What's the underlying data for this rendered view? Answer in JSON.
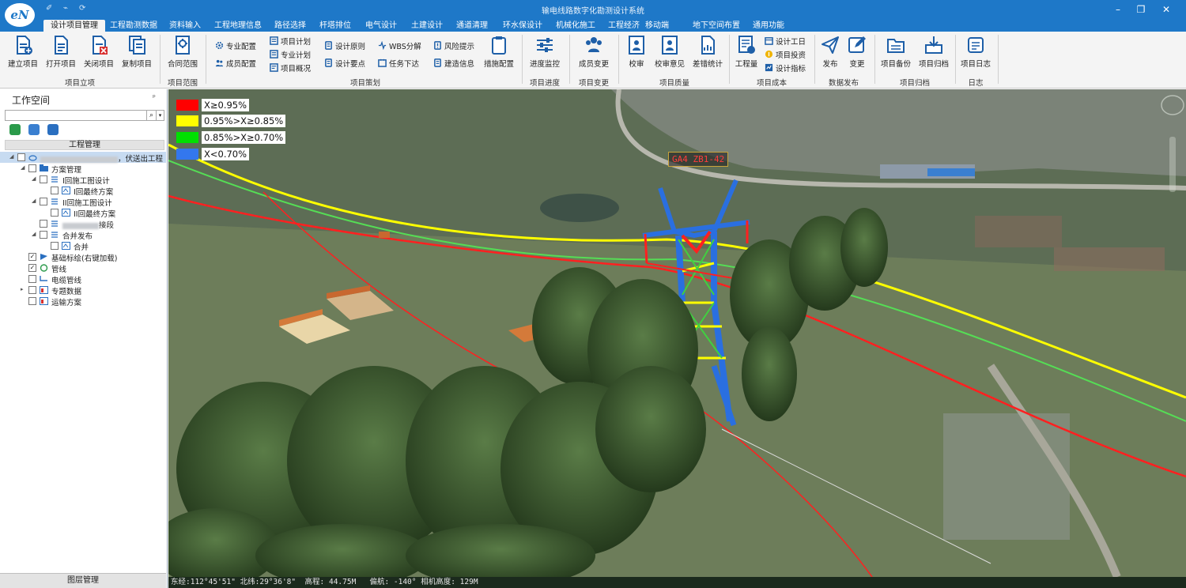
{
  "app": {
    "title": "输电线路数字化勘测设计系统",
    "logo_text": "eN",
    "quick_access": [
      "✐",
      "⌁",
      "⟳"
    ]
  },
  "tabs": [
    "设计项目管理",
    "工程勘测数据",
    "资料输入",
    "工程地理信息",
    "路径选择",
    "杆塔排位",
    "电气设计",
    "土建设计",
    "通道清理",
    "环水保设计",
    "机械化施工",
    "工程经济",
    "移动端",
    "地下空间布置",
    "通用功能"
  ],
  "ribbon": {
    "new_project": "建立项目",
    "open_project": "打开项目",
    "close_project": "关闭项目",
    "copy_project": "复制项目",
    "group_setup": "项目立项",
    "contract_scope": "合同范围",
    "group_scope": "项目范围",
    "specialty_config": "专业配置",
    "member_config": "成员配置",
    "project_plan": "项目计划",
    "specialty_plan": "专业计划",
    "project_overview": "项目概况",
    "design_principle": "设计原则",
    "design_points": "设计要点",
    "wbs": "WBS分解",
    "task_assign": "任务下达",
    "risk_tip": "风险提示",
    "construction_info": "建造信息",
    "measure_config": "措施配置",
    "group_planning": "项目策划",
    "progress_monitor": "进度监控",
    "group_progress": "项目进度",
    "member_change": "成员变更",
    "group_change": "项目变更",
    "proofread": "校审",
    "proofread_opinion": "校审意见",
    "error_stats": "差错统计",
    "group_quality": "项目质量",
    "quantities": "工程量",
    "design_hours": "设计工日",
    "project_invest": "项目投资",
    "design_index": "设计指标",
    "group_cost": "项目成本",
    "publish": "发布",
    "change": "变更",
    "group_publish": "数据发布",
    "backup": "项目备份",
    "archive": "项目归档",
    "group_archive": "项目归档",
    "project_log": "项目日志",
    "group_log": "日志"
  },
  "workspace": {
    "title": "工作空间",
    "pin": "ᵖ",
    "search_placeholder": "",
    "search_icon": "search-icon",
    "project_header": "工程管理",
    "tree": [
      {
        "label": "，伏送出工程",
        "checked": false
      },
      {
        "label": "方案管理",
        "checked": false
      },
      {
        "label": "I回施工图设计",
        "checked": false
      },
      {
        "label": "I回最终方案",
        "checked": false
      },
      {
        "label": "II回施工图设计",
        "checked": false
      },
      {
        "label": "II回最终方案",
        "checked": false
      },
      {
        "label": "接段",
        "checked": false
      },
      {
        "label": "合并发布",
        "checked": false
      },
      {
        "label": "合并",
        "checked": false
      },
      {
        "label": "基础标绘(右键加载)",
        "checked": true
      },
      {
        "label": "管线",
        "checked": true
      },
      {
        "label": "电缆管线",
        "checked": false
      },
      {
        "label": "专题数据",
        "checked": false
      },
      {
        "label": "运输方案",
        "checked": false
      }
    ],
    "layer_manager": "图层管理"
  },
  "legend": [
    {
      "label": "X≥0.95%",
      "color": "#ff0000"
    },
    {
      "label": "0.95%>X≥0.85%",
      "color": "#ffff00"
    },
    {
      "label": "0.85%>X≥0.70%",
      "color": "#00e000"
    },
    {
      "label": "X<0.70%",
      "color": "#3377ee"
    }
  ],
  "tower_label": "GA4 ZB1-42",
  "status": {
    "text": "东经:112°45'51\" 北纬:29°36'8\"  高程: 44.75M   偏航: -140° 相机高度: 129M"
  },
  "colors": {
    "titlebar": "#1e78c8",
    "ribbon_bg": "#f4f4f4",
    "selected_row": "#c7dbf1"
  }
}
